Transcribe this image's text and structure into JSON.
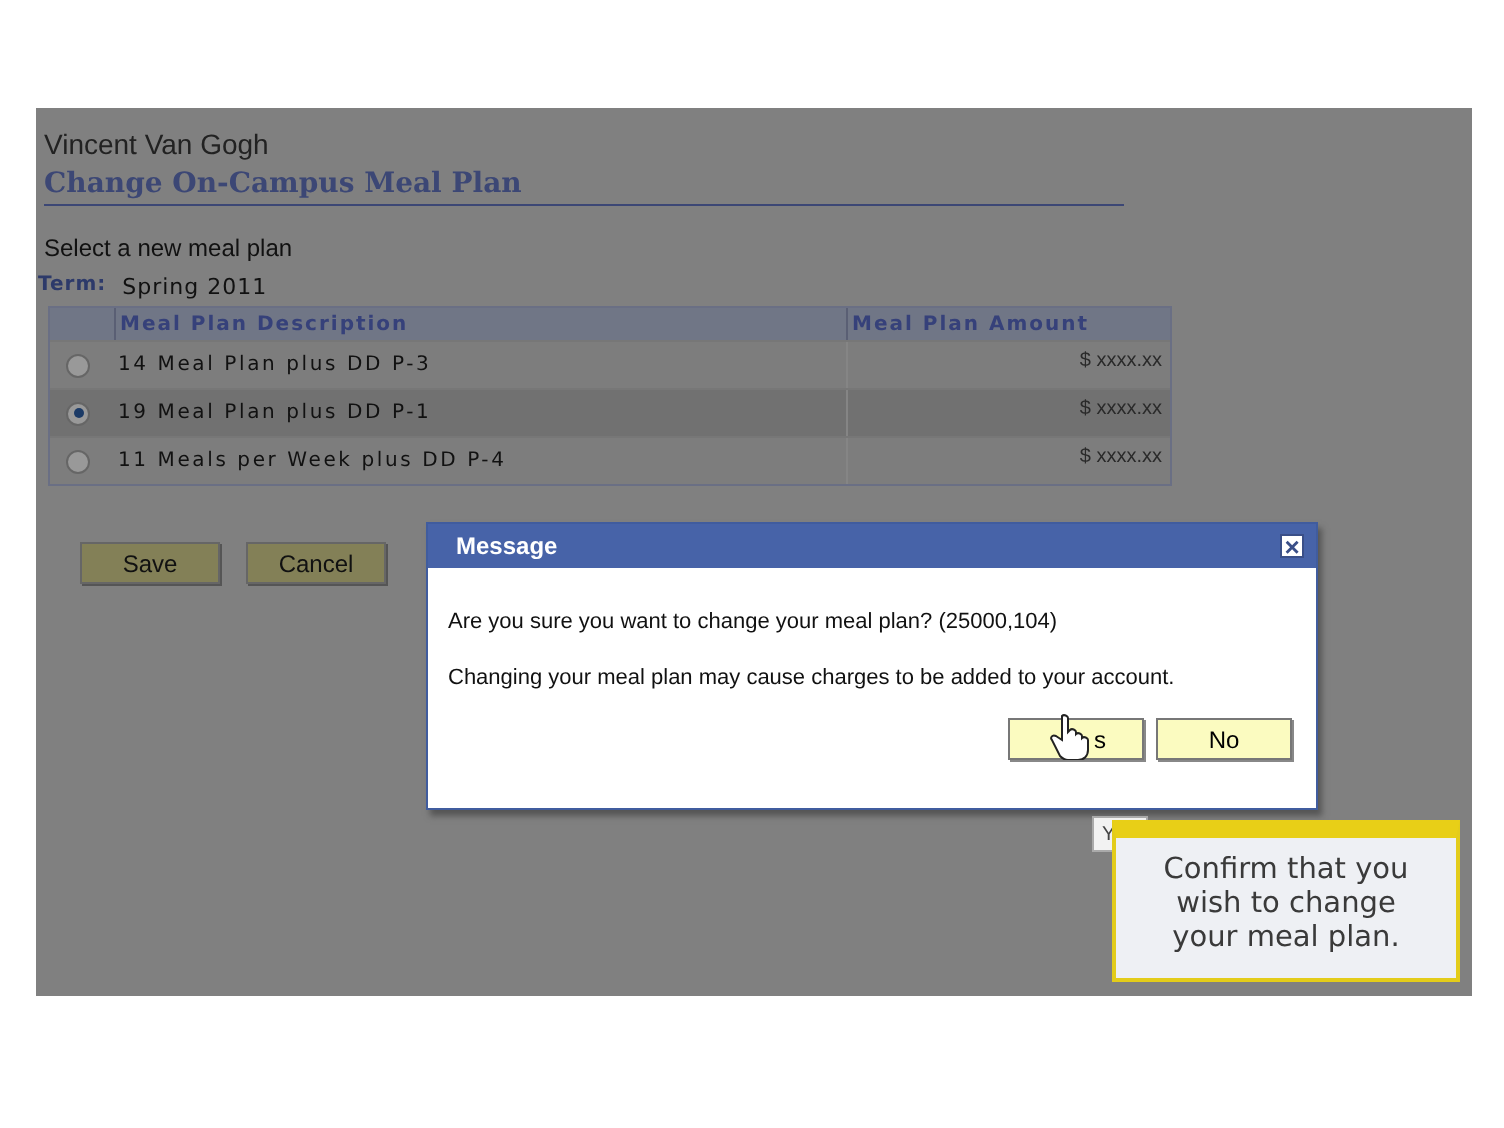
{
  "page": {
    "user_name": "Vincent Van Gogh",
    "title": "Change On-Campus Meal Plan",
    "instruction": "Select a new meal plan",
    "term_label": "Term:",
    "term_value": "Spring 2011"
  },
  "table": {
    "columns": [
      "Meal Plan Description",
      "Meal Plan Amount"
    ],
    "rows": [
      {
        "description": "14 Meal Plan plus DD P-3",
        "amount": "$ xxxx.xx",
        "selected": false
      },
      {
        "description": "19 Meal Plan plus DD P-1",
        "amount": "$ xxxx.xx",
        "selected": true
      },
      {
        "description": "11 Meals per Week plus DD P-4",
        "amount": "$ xxxx.xx",
        "selected": false
      }
    ]
  },
  "buttons": [
    "Save",
    "Cancel"
  ],
  "dialog": {
    "title": "Message",
    "close": "×",
    "question": "Are you sure you want to change your meal plan? (25000,104)",
    "note": "Changing your meal plan may cause charges to be added to your account.",
    "yes_visible": "s",
    "no": "No",
    "tooltip": "Y"
  },
  "callout": {
    "text": "Confirm that you wish to change your meal plan."
  }
}
